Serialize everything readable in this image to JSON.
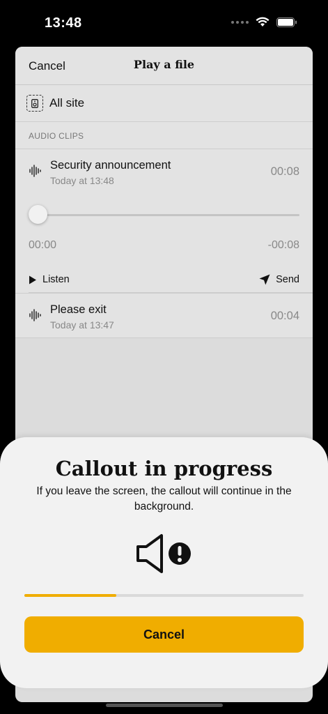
{
  "status": {
    "time": "13:48"
  },
  "nav": {
    "cancel_label": "Cancel",
    "title": "Play a file"
  },
  "target": {
    "label": "All site"
  },
  "section": {
    "audio_clips_header": "AUDIO CLIPS"
  },
  "clips": [
    {
      "name": "Security announcement",
      "time": "Today at 13:48",
      "duration": "00:08"
    },
    {
      "name": "Please exit",
      "time": "Today at 13:47",
      "duration": "00:04"
    }
  ],
  "player": {
    "elapsed": "00:00",
    "remaining": "-00:08",
    "position_fraction": 0.0,
    "listen_label": "Listen",
    "send_label": "Send"
  },
  "modal": {
    "title": "Callout in progress",
    "body": "If you leave the screen, the callout will continue in the background.",
    "progress_fraction": 0.33,
    "cancel_label": "Cancel"
  },
  "colors": {
    "accent": "#f0ad00",
    "sheet": "#e3e3e3",
    "modal": "#f2f2f2"
  }
}
